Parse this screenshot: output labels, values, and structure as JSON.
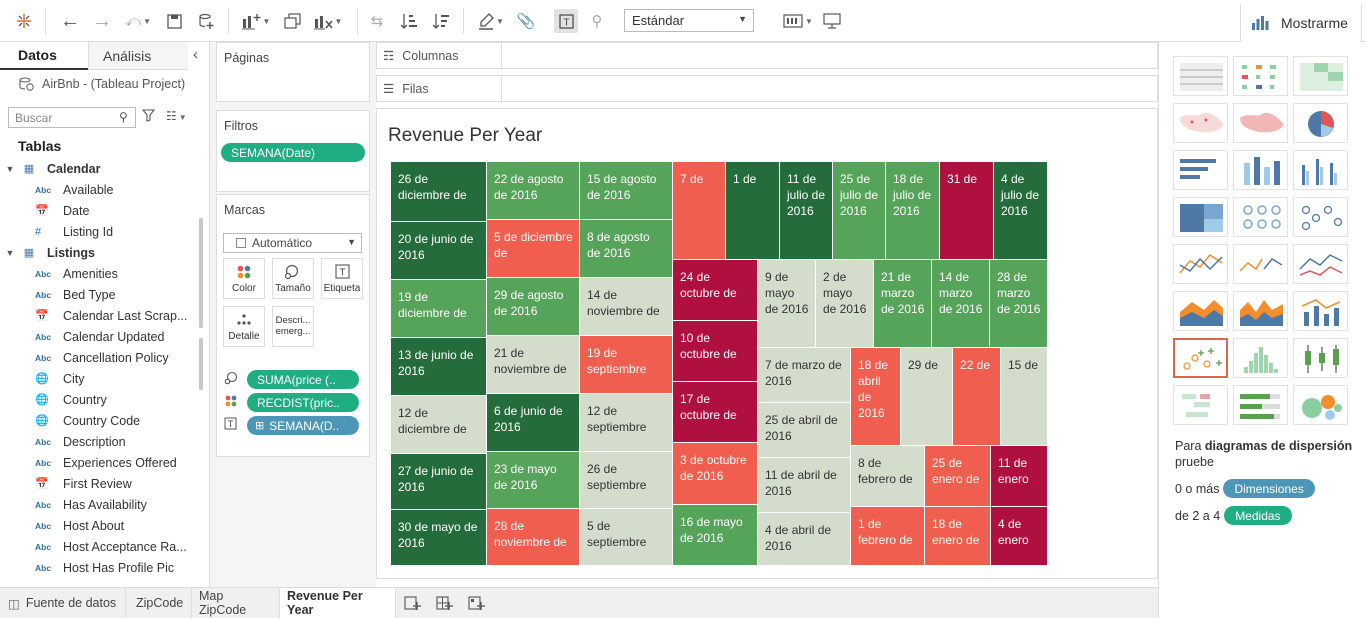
{
  "toolbar": {
    "mode_select": "Estándar",
    "show_me_label": "Mostrarme"
  },
  "datapane": {
    "tab_data": "Datos",
    "tab_analysis": "Análisis",
    "source": "AirBnb - (Tableau Project)",
    "search_placeholder": "Buscar",
    "tables_heading": "Tablas",
    "abc": "Abc",
    "items": [
      {
        "label": "Calendar",
        "kind": "table"
      },
      {
        "label": "Available",
        "kind": "abc"
      },
      {
        "label": "Date",
        "kind": "date"
      },
      {
        "label": "Listing Id",
        "kind": "num"
      },
      {
        "label": "Listings",
        "kind": "table"
      },
      {
        "label": "Amenities",
        "kind": "abc"
      },
      {
        "label": "Bed Type",
        "kind": "abc"
      },
      {
        "label": "Calendar Last Scrap...",
        "kind": "date"
      },
      {
        "label": "Calendar Updated",
        "kind": "abc"
      },
      {
        "label": "Cancellation Policy",
        "kind": "abc"
      },
      {
        "label": "City",
        "kind": "geo"
      },
      {
        "label": "Country",
        "kind": "geo"
      },
      {
        "label": "Country Code",
        "kind": "geo"
      },
      {
        "label": "Description",
        "kind": "abc"
      },
      {
        "label": "Experiences Offered",
        "kind": "abc"
      },
      {
        "label": "First Review",
        "kind": "date"
      },
      {
        "label": "Has Availability",
        "kind": "abc"
      },
      {
        "label": "Host About",
        "kind": "abc"
      },
      {
        "label": "Host Acceptance Ra...",
        "kind": "abc"
      },
      {
        "label": "Host Has Profile Pic",
        "kind": "abc"
      }
    ]
  },
  "shelves": {
    "pages": "Páginas",
    "filters": "Filtros",
    "filter_pill": "SEMANA(Date)",
    "marks": "Marcas",
    "mark_type": "Automático",
    "btn_color": "Color",
    "btn_size": "Tamaño",
    "btn_label": "Etiqueta",
    "btn_detail": "Detalle",
    "btn_tooltip_1": "Descri...",
    "btn_tooltip_2": "emerg...",
    "mark_pill_1": "SUMA(price (..",
    "mark_pill_2": "RECDIST(pric..",
    "mark_pill_3": "SEMANA(D..",
    "columns": "Columnas",
    "rows": "Filas"
  },
  "viz": {
    "title": "Revenue Per Year"
  },
  "chart_data": {
    "type": "treemap",
    "title": "Revenue Per Year",
    "tiles": [
      {
        "label": "26 de diciembre de",
        "color": "#256c3c"
      },
      {
        "label": "20 de junio de 2016",
        "color": "#256c3c"
      },
      {
        "label": "19 de diciembre de",
        "color": "#56a35a"
      },
      {
        "label": "13 de junio de 2016",
        "color": "#256c3c"
      },
      {
        "label": "12 de diciembre de",
        "color": "#d4dccb"
      },
      {
        "label": "27 de junio de 2016",
        "color": "#256c3c"
      },
      {
        "label": "30 de mayo de 2016",
        "color": "#256c3c"
      },
      {
        "label": "22 de agosto de 2016",
        "color": "#56a35a"
      },
      {
        "label": "15 de agosto de 2016",
        "color": "#56a35a"
      },
      {
        "label": "5 de diciembre de",
        "color": "#ef5e4e"
      },
      {
        "label": "8 de agosto de 2016",
        "color": "#56a35a"
      },
      {
        "label": "29 de agosto de 2016",
        "color": "#56a35a"
      },
      {
        "label": "14 de noviembre de",
        "color": "#d4dccb"
      },
      {
        "label": "21 de noviembre de",
        "color": "#d4dccb"
      },
      {
        "label": "19 de septiembre",
        "color": "#ef5e4e"
      },
      {
        "label": "6 de junio de 2016",
        "color": "#256c3c"
      },
      {
        "label": "12 de septiembre",
        "color": "#d4dccb"
      },
      {
        "label": "23 de mayo de 2016",
        "color": "#56a35a"
      },
      {
        "label": "26 de septiembre",
        "color": "#d4dccb"
      },
      {
        "label": "28 de noviembre de",
        "color": "#ef5e4e"
      },
      {
        "label": "5 de septiembre",
        "color": "#d4dccb"
      },
      {
        "label": "7 de",
        "color": "#ef5e4e"
      },
      {
        "label": "1 de",
        "color": "#256c3c"
      },
      {
        "label": "11 de julio de 2016",
        "color": "#256c3c"
      },
      {
        "label": "25 de julio de 2016",
        "color": "#56a35a"
      },
      {
        "label": "18 de julio de 2016",
        "color": "#56a35a"
      },
      {
        "label": "31 de",
        "color": "#b0103f"
      },
      {
        "label": "4 de julio de 2016",
        "color": "#256c3c"
      },
      {
        "label": "24 de octubre de",
        "color": "#b0103f"
      },
      {
        "label": "10 de octubre de",
        "color": "#b0103f"
      },
      {
        "label": "17 de octubre de",
        "color": "#b0103f"
      },
      {
        "label": "3 de octubre de 2016",
        "color": "#ef5e4e"
      },
      {
        "label": "16 de mayo de 2016",
        "color": "#56a35a"
      },
      {
        "label": "9 de mayo de 2016",
        "color": "#d4dccb"
      },
      {
        "label": "2 de mayo de 2016",
        "color": "#d4dccb"
      },
      {
        "label": "21 de marzo de 2016",
        "color": "#56a35a"
      },
      {
        "label": "14 de marzo de 2016",
        "color": "#56a35a"
      },
      {
        "label": "28 de marzo de 2016",
        "color": "#56a35a"
      },
      {
        "label": "7 de marzo de 2016",
        "color": "#d4dccb"
      },
      {
        "label": "25 de abril de 2016",
        "color": "#d4dccb"
      },
      {
        "label": "11 de abril de 2016",
        "color": "#d4dccb"
      },
      {
        "label": "4 de abril de 2016",
        "color": "#d4dccb"
      },
      {
        "label": "18 de abril de 2016",
        "color": "#ef5e4e"
      },
      {
        "label": "29 de",
        "color": "#d4dccb"
      },
      {
        "label": "22 de",
        "color": "#ef5e4e"
      },
      {
        "label": "15 de",
        "color": "#d4dccb"
      },
      {
        "label": "8 de febrero de",
        "color": "#d4dccb"
      },
      {
        "label": "25 de enero de",
        "color": "#ef5e4e"
      },
      {
        "label": "11 de enero",
        "color": "#b0103f"
      },
      {
        "label": "1 de febrero de",
        "color": "#ef5e4e"
      },
      {
        "label": "18 de enero de",
        "color": "#ef5e4e"
      },
      {
        "label": "4 de enero",
        "color": "#b0103f"
      }
    ]
  },
  "showme": {
    "hint_pre": "Para",
    "hint_bold": "diagramas de dispersión",
    "hint_post": "pruebe",
    "dims_pre": "0 o más",
    "dims_pill": "Dimensiones",
    "meas_pre": "de 2 a 4",
    "meas_pill": "Medidas"
  },
  "sheets": [
    "Fuente de datos",
    "ZipCode",
    "Map ZipCode",
    "Revenue Per Year"
  ]
}
